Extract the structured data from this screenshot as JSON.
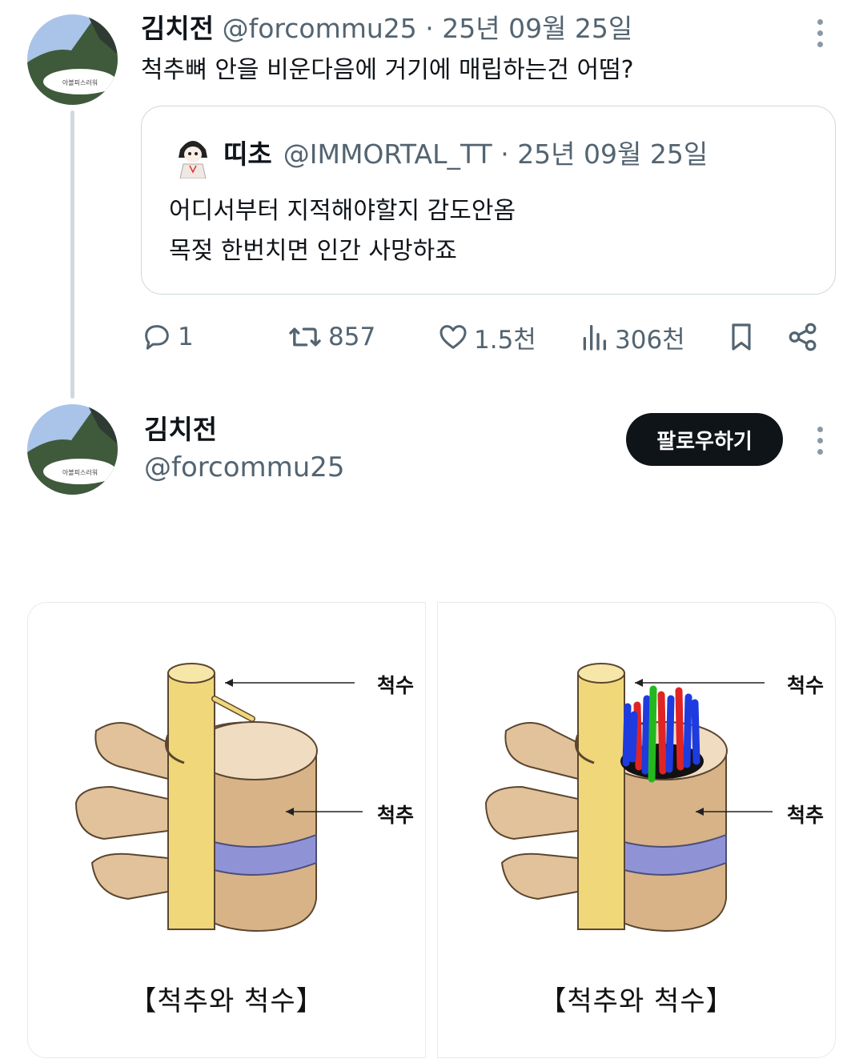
{
  "tweet": {
    "author_name": "김치전",
    "author_handle": "@forcommu25",
    "date": " · 25년 09월 25일",
    "text": "척추뼈 안을 비운다음에 거기에 매립하는건 어떰?",
    "avatar_badge": "아볼피스러워"
  },
  "quoted": {
    "author_name": "띠초",
    "author_handle": "@IMMORTAL_TT",
    "date": " · 25년 09월 25일",
    "lines": [
      "어디서부터 지적해야할지 감도안옴",
      "목젖 한번치면 인간 사망하죠"
    ]
  },
  "actions": {
    "replies": "1",
    "retweets": "857",
    "likes": "1.5천",
    "views": "306천"
  },
  "profile": {
    "name": "김치전",
    "handle": "@forcommu25",
    "follow_label": "팔로우하기"
  },
  "figures": [
    {
      "label_top": "척수",
      "label_mid": "척추",
      "caption": "【척추와 척수】"
    },
    {
      "label_top": "척수",
      "label_mid": "척추",
      "caption": "【척추와 척수】"
    }
  ],
  "colors": {
    "text_primary": "#0f1419",
    "text_secondary": "#536471",
    "border": "#cfd9de",
    "button_bg": "#0f1419"
  },
  "icons": [
    "more-icon",
    "reply-icon",
    "retweet-icon",
    "like-icon",
    "views-icon",
    "bookmark-icon",
    "share-icon"
  ]
}
